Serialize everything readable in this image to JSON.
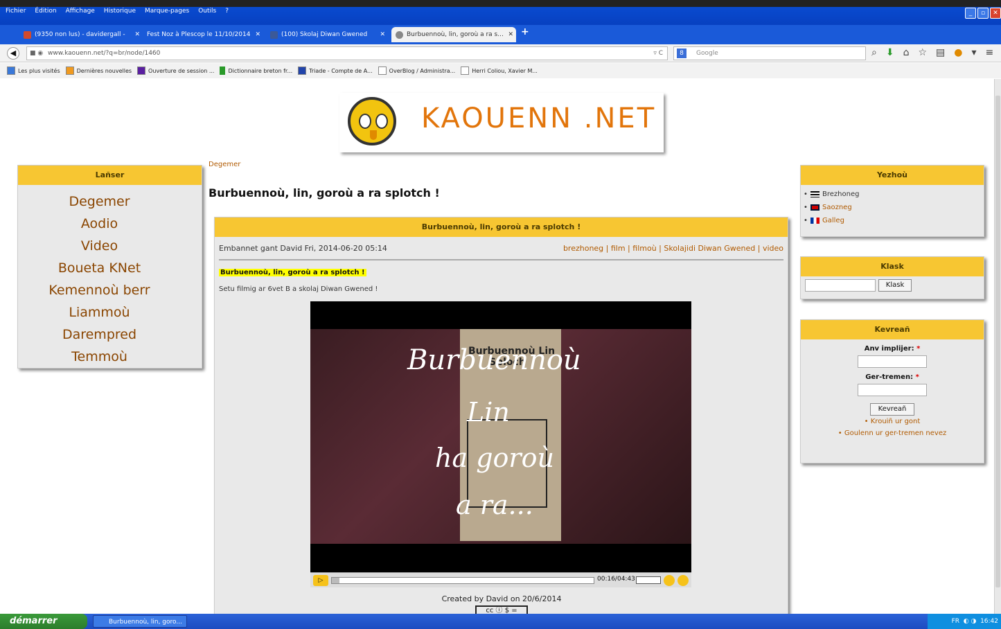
{
  "browser": {
    "menu": [
      "Fichier",
      "Édition",
      "Affichage",
      "Historique",
      "Marque-pages",
      "Outils",
      "?"
    ],
    "tabs": [
      {
        "label": "(9350 non lus) - davidergall -",
        "color": "#d24a2b"
      },
      {
        "label": "Fest Noz à Plescop le 11/10/2014",
        "color": "#3b6ed9"
      },
      {
        "label": "(100) Skolaj Diwan Gwened",
        "color": "#3b5998"
      },
      {
        "label": "Burbuennoù, lin, goroù a ra s...",
        "color": "#888888"
      }
    ],
    "new_tab": "+",
    "url": "www.kaouenn.net/?q=br/node/1460",
    "search_engine": "Google",
    "bookmarks": [
      "Les plus visités",
      "Dernières nouvelles",
      "Ouverture de session ...",
      "Dictionnaire breton fr...",
      "Triade - Compte de A...",
      "OverBlog / Administra...",
      "Herri Coliou, Xavier M..."
    ]
  },
  "site": {
    "logo_text": "KAOUENN .NET",
    "breadcrumb": "Degemer",
    "page_title": "Burbuennoù, lin, goroù a ra splotch !",
    "left_menu": {
      "title": "Lañser",
      "items": [
        "Degemer",
        "Aodio",
        "Video",
        "Boueta KNet",
        "Kemennoù berr",
        "Liammoù",
        "Darempred",
        "Temmoù"
      ]
    },
    "article": {
      "header": "Burbuennoù, lin, goroù a ra splotch !",
      "meta": "Embannet gant David Fri, 2014-06-20 05:14",
      "tags": "brezhoneg | film | filmoù | Skolajidi Diwan Gwened | video",
      "highlight": "Burbuennoù, lin, goroù a ra splotch !",
      "subtitle": "Setu filmig ar 6vet B a skolaj Diwan Gwened !",
      "video": {
        "poster_title": "Burbuennoù Lin",
        "poster_sub": "Sploch",
        "line1": "Burbuennoù",
        "line2": "Lin",
        "line3": "ha goroù",
        "line4": "a ra...",
        "time": "00:16/04:43",
        "progress": 0.03
      },
      "credit": "Created by David on 20/6/2014"
    },
    "languages": {
      "title": "Yezhoù",
      "items": [
        "Brezhoneg",
        "Saozneg",
        "Galleg"
      ]
    },
    "search": {
      "title": "Klask",
      "button": "Klask"
    },
    "login": {
      "title": "Kevreañ",
      "user_label": "Anv implijer:",
      "pass_label": "Ger-tremen:",
      "required": "*",
      "button": "Kevreañ",
      "links": [
        "Krouiñ ur gont",
        "Goulenn ur ger-tremen nevez"
      ]
    }
  },
  "taskbar": {
    "start": "démarrer",
    "task": "Burbuennoù, lin, goro...",
    "lang": "FR",
    "clock": "16:42"
  }
}
